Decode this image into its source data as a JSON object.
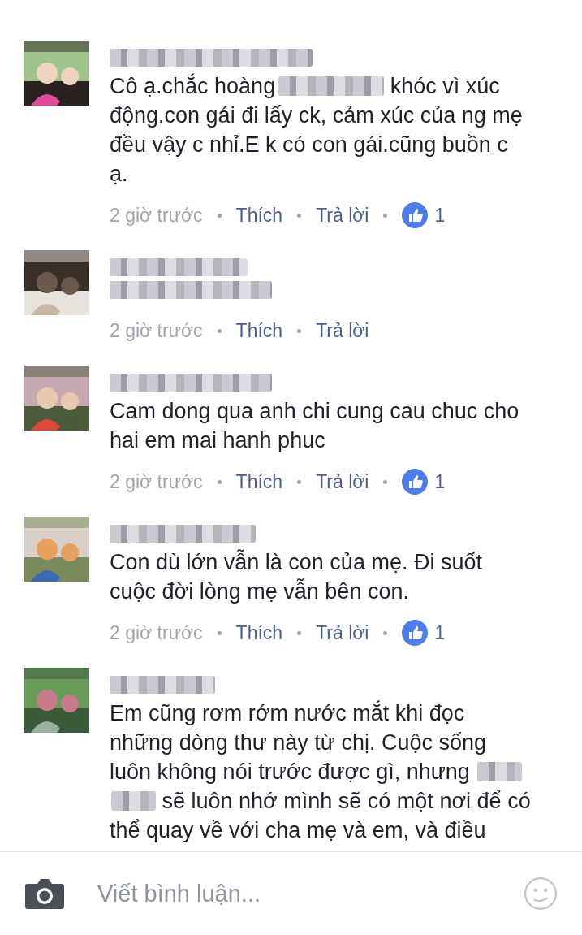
{
  "comments": [
    {
      "avatar": {
        "kind": "picture"
      },
      "name_lines": [
        {
          "kind": "blurred"
        }
      ],
      "body": [
        {
          "kind": "text",
          "text": "Cô ạ.chắc hoàng"
        },
        {
          "kind": "redacted"
        },
        {
          "kind": "text",
          "text": " khóc vì xúc động.con gái đi lấy ck, cảm xúc của ng mẹ đều vậy c nhỉ.E k có con gái.cũng buồn c ạ."
        }
      ],
      "time": "2 giờ trước",
      "like_label": "Thích",
      "reply_label": "Trả lời",
      "likes": "1"
    },
    {
      "avatar": {
        "kind": "picture"
      },
      "name_lines": [
        {
          "kind": "blurred"
        },
        {
          "kind": "blurred"
        }
      ],
      "time": "2 giờ trước",
      "like_label": "Thích",
      "reply_label": "Trả lời"
    },
    {
      "avatar": {
        "kind": "picture"
      },
      "name_lines": [
        {
          "kind": "blurred"
        }
      ],
      "body": [
        {
          "kind": "text",
          "text": "Cam dong qua anh chi cung cau chuc cho hai em mai hanh phuc"
        }
      ],
      "time": "2 giờ trước",
      "like_label": "Thích",
      "reply_label": "Trả lời",
      "likes": "1"
    },
    {
      "avatar": {
        "kind": "picture"
      },
      "name_lines": [
        {
          "kind": "blurred"
        }
      ],
      "body": [
        {
          "kind": "text",
          "text": "Con dù lớn vẫn là con của mẹ. Đi suốt cuộc đời lòng mẹ vẫn bên con."
        }
      ],
      "time": "2 giờ trước",
      "like_label": "Thích",
      "reply_label": "Trả lời",
      "likes": "1"
    },
    {
      "avatar": {
        "kind": "picture"
      },
      "name_lines": [
        {
          "kind": "blurred"
        }
      ],
      "body": [
        {
          "kind": "text",
          "text": "Em cũng rơm rớm nước mắt khi đọc những dòng thư này từ chị. Cuộc sống luôn không nói trước được gì, nhưng "
        },
        {
          "kind": "redacted"
        },
        {
          "kind": "redacted"
        },
        {
          "kind": "text",
          "text": " sẽ luôn nhớ mình sẽ có một nơi để có thể quay về với cha mẹ và em, và điều"
        }
      ]
    }
  ],
  "composer": {
    "placeholder": "Viết bình luận..."
  }
}
